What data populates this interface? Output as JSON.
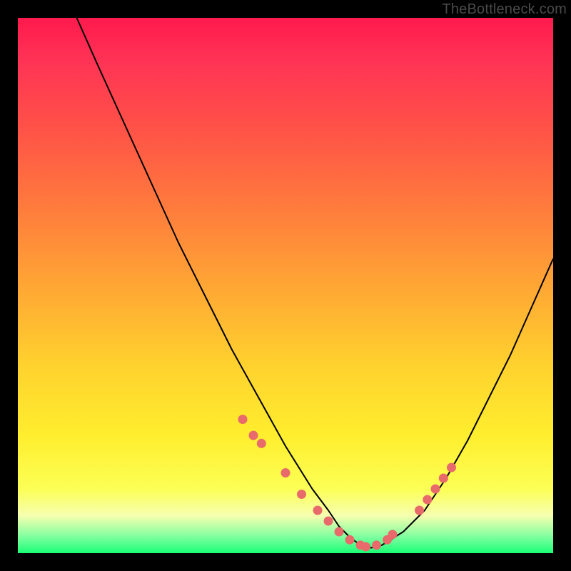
{
  "watermark": "TheBottleneck.com",
  "chart_data": {
    "type": "line",
    "title": "",
    "xlabel": "",
    "ylabel": "",
    "xlim": [
      0,
      100
    ],
    "ylim": [
      0,
      100
    ],
    "grid": false,
    "series": [
      {
        "name": "bottleneck-curve",
        "color": "#000000",
        "x": [
          11,
          15,
          20,
          25,
          30,
          35,
          40,
          45,
          50,
          55,
          58,
          60,
          62,
          64,
          66,
          68,
          72,
          76,
          80,
          84,
          88,
          92,
          96,
          100
        ],
        "y": [
          100,
          91,
          80,
          69,
          58,
          48,
          38,
          29,
          20,
          12,
          8,
          5,
          3,
          1.5,
          1,
          1.5,
          4,
          8,
          14,
          21,
          29,
          37,
          46,
          55
        ]
      },
      {
        "name": "marker-dots",
        "color": "#e86a6a",
        "type": "scatter",
        "x": [
          42,
          44,
          45.5,
          50,
          53,
          56,
          58,
          60,
          62,
          64,
          65,
          67,
          69,
          70,
          75,
          76.5,
          78,
          79.5,
          81
        ],
        "y": [
          25,
          22,
          20.5,
          15,
          11,
          8,
          6,
          4,
          2.5,
          1.5,
          1.2,
          1.5,
          2.5,
          3.5,
          8,
          10,
          12,
          14,
          16
        ]
      }
    ],
    "background_gradient": {
      "type": "vertical",
      "stops": [
        {
          "pos": 0.0,
          "color": "#ff1a4d"
        },
        {
          "pos": 0.35,
          "color": "#ff7a3d"
        },
        {
          "pos": 0.65,
          "color": "#ffd22e"
        },
        {
          "pos": 0.9,
          "color": "#fcff55"
        },
        {
          "pos": 1.0,
          "color": "#1aff76"
        }
      ]
    }
  }
}
